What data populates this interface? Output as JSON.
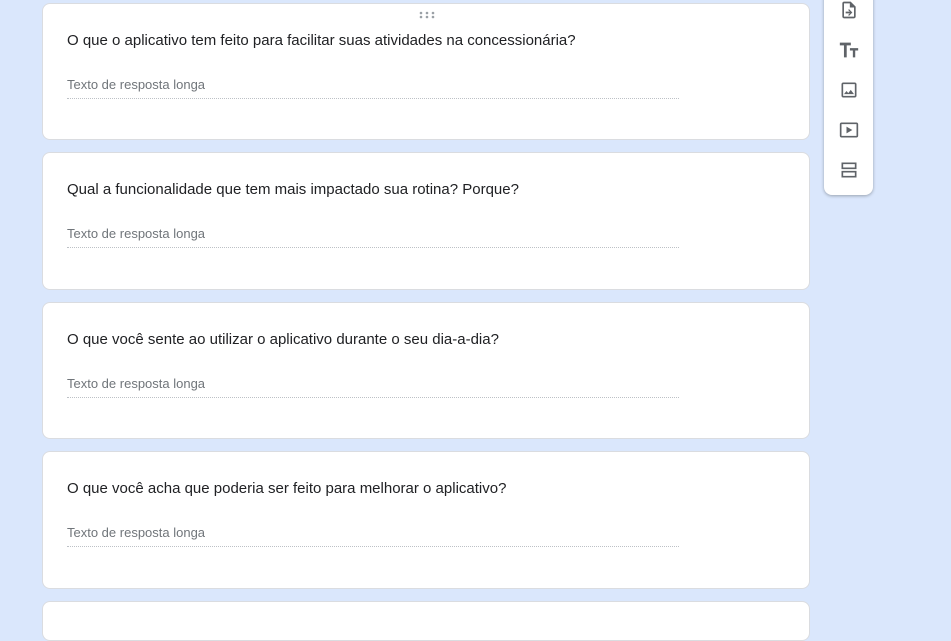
{
  "questions": [
    {
      "title": "O que o aplicativo tem feito para facilitar suas atividades na concessionária?",
      "answer_placeholder": "Texto de resposta longa"
    },
    {
      "title": "Qual a funcionalidade que tem mais impactado sua rotina? Porque?",
      "answer_placeholder": "Texto de resposta longa"
    },
    {
      "title": "O que você sente ao utilizar o aplicativo durante o seu dia-a-dia?",
      "answer_placeholder": "Texto de resposta longa"
    },
    {
      "title": "O que você acha que poderia ser feito para melhorar o aplicativo?",
      "answer_placeholder": "Texto de resposta longa"
    }
  ],
  "toolbar": {
    "items": [
      "import-questions-icon",
      "add-title-icon",
      "add-image-icon",
      "add-video-icon",
      "add-section-icon"
    ]
  },
  "colors": {
    "background": "#dae7fc",
    "card": "#ffffff",
    "text": "#202124",
    "placeholder": "#70757a",
    "icon": "#5f6368"
  }
}
